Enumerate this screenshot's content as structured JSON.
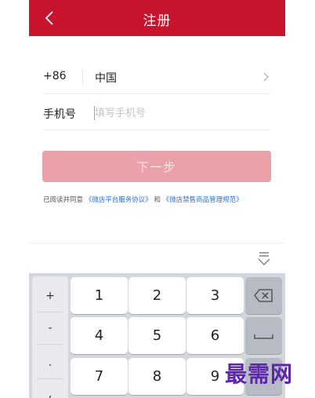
{
  "header": {
    "title": "注册",
    "back_icon": "chevron-left-icon"
  },
  "form": {
    "country_code": "+86",
    "country_name": "中国",
    "phone_label": "手机号",
    "phone_placeholder": "填写手机号",
    "phone_value": ""
  },
  "next_button": {
    "label": "下一步"
  },
  "agreement": {
    "prefix": "已阅读并同意",
    "link1": "《微店平台服务协议》",
    "conj": "和",
    "link2": "《微店禁售商品管理规范》"
  },
  "keyboard": {
    "symbols": [
      "+",
      "-",
      ".",
      ","
    ],
    "rows": [
      [
        "1",
        "2",
        "3"
      ],
      [
        "4",
        "5",
        "6"
      ],
      [
        "7",
        "8",
        "9"
      ]
    ]
  },
  "watermark": "最需网",
  "colors": {
    "brand_red": "#c8142c",
    "button_disabled": "#eba1a9",
    "link_blue": "#2f6fca"
  }
}
